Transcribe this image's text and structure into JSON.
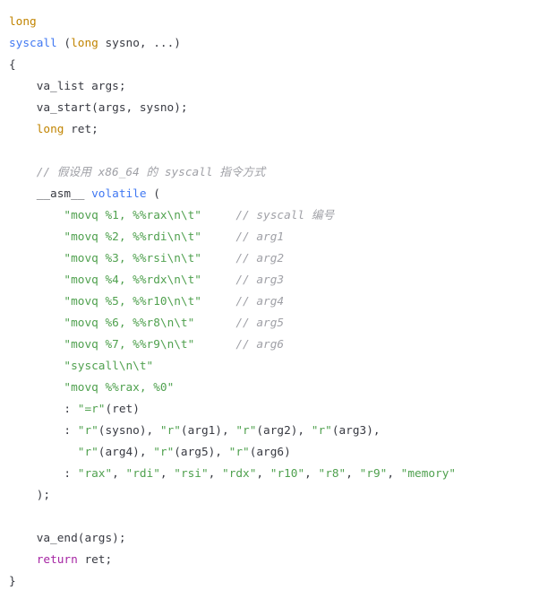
{
  "theme": {
    "background": "#ffffff",
    "plain": "#383a42",
    "keyword": "#c18401",
    "function": "#4078f2",
    "string": "#50a14f",
    "comment": "#a0a1a7",
    "control": "#a626a4"
  },
  "code": {
    "lines": [
      [
        {
          "keyword": "long"
        }
      ],
      [
        {
          "function": "syscall"
        },
        {
          "plain": " ("
        },
        {
          "keyword": "long"
        },
        {
          "plain": " sysno, ...)"
        }
      ],
      [
        {
          "plain": "{"
        }
      ],
      [
        {
          "plain": "    va_list args;"
        }
      ],
      [
        {
          "plain": "    va_start(args, sysno);"
        }
      ],
      [
        {
          "plain": "    "
        },
        {
          "keyword": "long"
        },
        {
          "plain": " ret;"
        }
      ],
      [],
      [
        {
          "plain": "    "
        },
        {
          "comment": "// 假设用 x86_64 的 syscall 指令方式"
        }
      ],
      [
        {
          "plain": "    __asm__ "
        },
        {
          "function": "volatile"
        },
        {
          "plain": " ("
        }
      ],
      [
        {
          "plain": "        "
        },
        {
          "string": "\"movq %1, %%rax\\n\\t\""
        },
        {
          "plain": "     "
        },
        {
          "comment": "// syscall 编号"
        }
      ],
      [
        {
          "plain": "        "
        },
        {
          "string": "\"movq %2, %%rdi\\n\\t\""
        },
        {
          "plain": "     "
        },
        {
          "comment": "// arg1"
        }
      ],
      [
        {
          "plain": "        "
        },
        {
          "string": "\"movq %3, %%rsi\\n\\t\""
        },
        {
          "plain": "     "
        },
        {
          "comment": "// arg2"
        }
      ],
      [
        {
          "plain": "        "
        },
        {
          "string": "\"movq %4, %%rdx\\n\\t\""
        },
        {
          "plain": "     "
        },
        {
          "comment": "// arg3"
        }
      ],
      [
        {
          "plain": "        "
        },
        {
          "string": "\"movq %5, %%r10\\n\\t\""
        },
        {
          "plain": "     "
        },
        {
          "comment": "// arg4"
        }
      ],
      [
        {
          "plain": "        "
        },
        {
          "string": "\"movq %6, %%r8\\n\\t\""
        },
        {
          "plain": "      "
        },
        {
          "comment": "// arg5"
        }
      ],
      [
        {
          "plain": "        "
        },
        {
          "string": "\"movq %7, %%r9\\n\\t\""
        },
        {
          "plain": "      "
        },
        {
          "comment": "// arg6"
        }
      ],
      [
        {
          "plain": "        "
        },
        {
          "string": "\"syscall\\n\\t\""
        }
      ],
      [
        {
          "plain": "        "
        },
        {
          "string": "\"movq %%rax, %0\""
        }
      ],
      [
        {
          "plain": "        : "
        },
        {
          "string": "\"=r\""
        },
        {
          "plain": "(ret)"
        }
      ],
      [
        {
          "plain": "        : "
        },
        {
          "string": "\"r\""
        },
        {
          "plain": "(sysno), "
        },
        {
          "string": "\"r\""
        },
        {
          "plain": "(arg1), "
        },
        {
          "string": "\"r\""
        },
        {
          "plain": "(arg2), "
        },
        {
          "string": "\"r\""
        },
        {
          "plain": "(arg3),"
        }
      ],
      [
        {
          "plain": "          "
        },
        {
          "string": "\"r\""
        },
        {
          "plain": "(arg4), "
        },
        {
          "string": "\"r\""
        },
        {
          "plain": "(arg5), "
        },
        {
          "string": "\"r\""
        },
        {
          "plain": "(arg6)"
        }
      ],
      [
        {
          "plain": "        : "
        },
        {
          "string": "\"rax\""
        },
        {
          "plain": ", "
        },
        {
          "string": "\"rdi\""
        },
        {
          "plain": ", "
        },
        {
          "string": "\"rsi\""
        },
        {
          "plain": ", "
        },
        {
          "string": "\"rdx\""
        },
        {
          "plain": ", "
        },
        {
          "string": "\"r10\""
        },
        {
          "plain": ", "
        },
        {
          "string": "\"r8\""
        },
        {
          "plain": ", "
        },
        {
          "string": "\"r9\""
        },
        {
          "plain": ", "
        },
        {
          "string": "\"memory\""
        }
      ],
      [
        {
          "plain": "    );"
        }
      ],
      [],
      [
        {
          "plain": "    va_end(args);"
        }
      ],
      [
        {
          "plain": "    "
        },
        {
          "control": "return"
        },
        {
          "plain": " ret;"
        }
      ],
      [
        {
          "plain": "}"
        }
      ]
    ]
  }
}
